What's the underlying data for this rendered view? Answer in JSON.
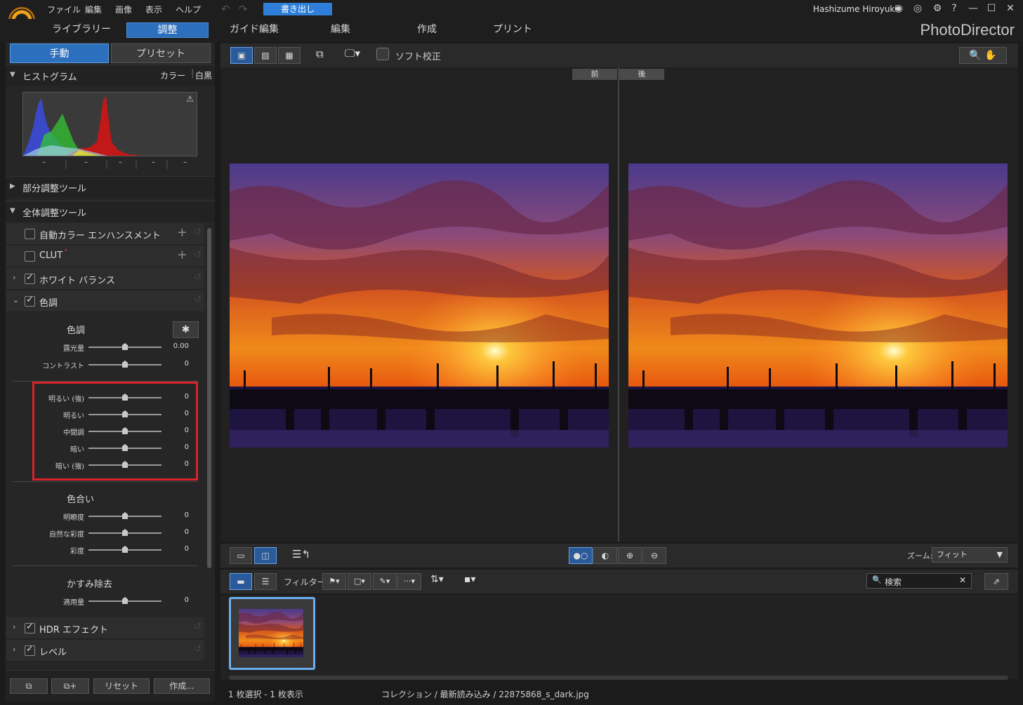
{
  "menu": [
    "ファイル",
    "編集",
    "画像",
    "表示",
    "ヘルプ"
  ],
  "export_label": "書き出し",
  "user_name": "Hashizume Hiroyuki",
  "module_tabs": [
    "ライブラリー",
    "調整",
    "ガイド編集",
    "編集",
    "作成",
    "プリント"
  ],
  "brand": "PhotoDirector",
  "left_tabs": {
    "manual": "手動",
    "preset": "プリセット"
  },
  "histogram": {
    "title": "ヒストグラム",
    "color": "カラー",
    "mono": "白黒",
    "ticks": [
      "–",
      "–",
      "–",
      "–",
      "–"
    ]
  },
  "sections": {
    "local": "部分調整ツール",
    "global": "全体調整ツール"
  },
  "tools": [
    {
      "label": "自動カラー エンハンスメント",
      "checked": false
    },
    {
      "label": "CLUT",
      "checked": false
    },
    {
      "label": "ホワイト バランス",
      "checked": true
    },
    {
      "label": "色調",
      "checked": true
    },
    {
      "label": "HDR エフェクト",
      "checked": true
    },
    {
      "label": "レベル",
      "checked": true
    }
  ],
  "tone": {
    "title": "色調",
    "sliders_top": [
      {
        "label": "露光量",
        "value": "0.00",
        "position": 0.5
      },
      {
        "label": "コントラスト",
        "value": "0",
        "position": 0.5
      }
    ],
    "sliders_range": [
      {
        "label": "明るい (強)",
        "value": "0",
        "position": 0.5
      },
      {
        "label": "明るい",
        "value": "0",
        "position": 0.5
      },
      {
        "label": "中間調",
        "value": "0",
        "position": 0.5
      },
      {
        "label": "暗い",
        "value": "0",
        "position": 0.5
      },
      {
        "label": "暗い (強)",
        "value": "0",
        "position": 0.5
      }
    ]
  },
  "hue": {
    "title": "色合い",
    "sliders": [
      {
        "label": "明瞭度",
        "value": "0",
        "position": 0.5
      },
      {
        "label": "自然な彩度",
        "value": "0",
        "position": 0.5
      },
      {
        "label": "彩度",
        "value": "0",
        "position": 0.5
      }
    ]
  },
  "dehaze": {
    "title": "かすみ除去",
    "sliders": [
      {
        "label": "適用量",
        "value": "0",
        "position": 0.5
      }
    ]
  },
  "bottom_buttons": {
    "reset": "リセット",
    "create": "作成..."
  },
  "toolbar": {
    "soft_proof": "ソフト校正"
  },
  "before_after": {
    "before": "前",
    "after": "後"
  },
  "zoom": {
    "label": "ズーム:",
    "value": "フィット"
  },
  "filter_label": "フィルター:",
  "search_placeholder": "検索",
  "status": {
    "selection": "1 枚選択 - 1 枚表示",
    "path": "コレクション / 最新読み込み / 22875868_s_dark.jpg"
  },
  "colors": {
    "accent": "#2c6fbd",
    "export": "#2f7fd9",
    "highlight_box": "#d8232a"
  }
}
